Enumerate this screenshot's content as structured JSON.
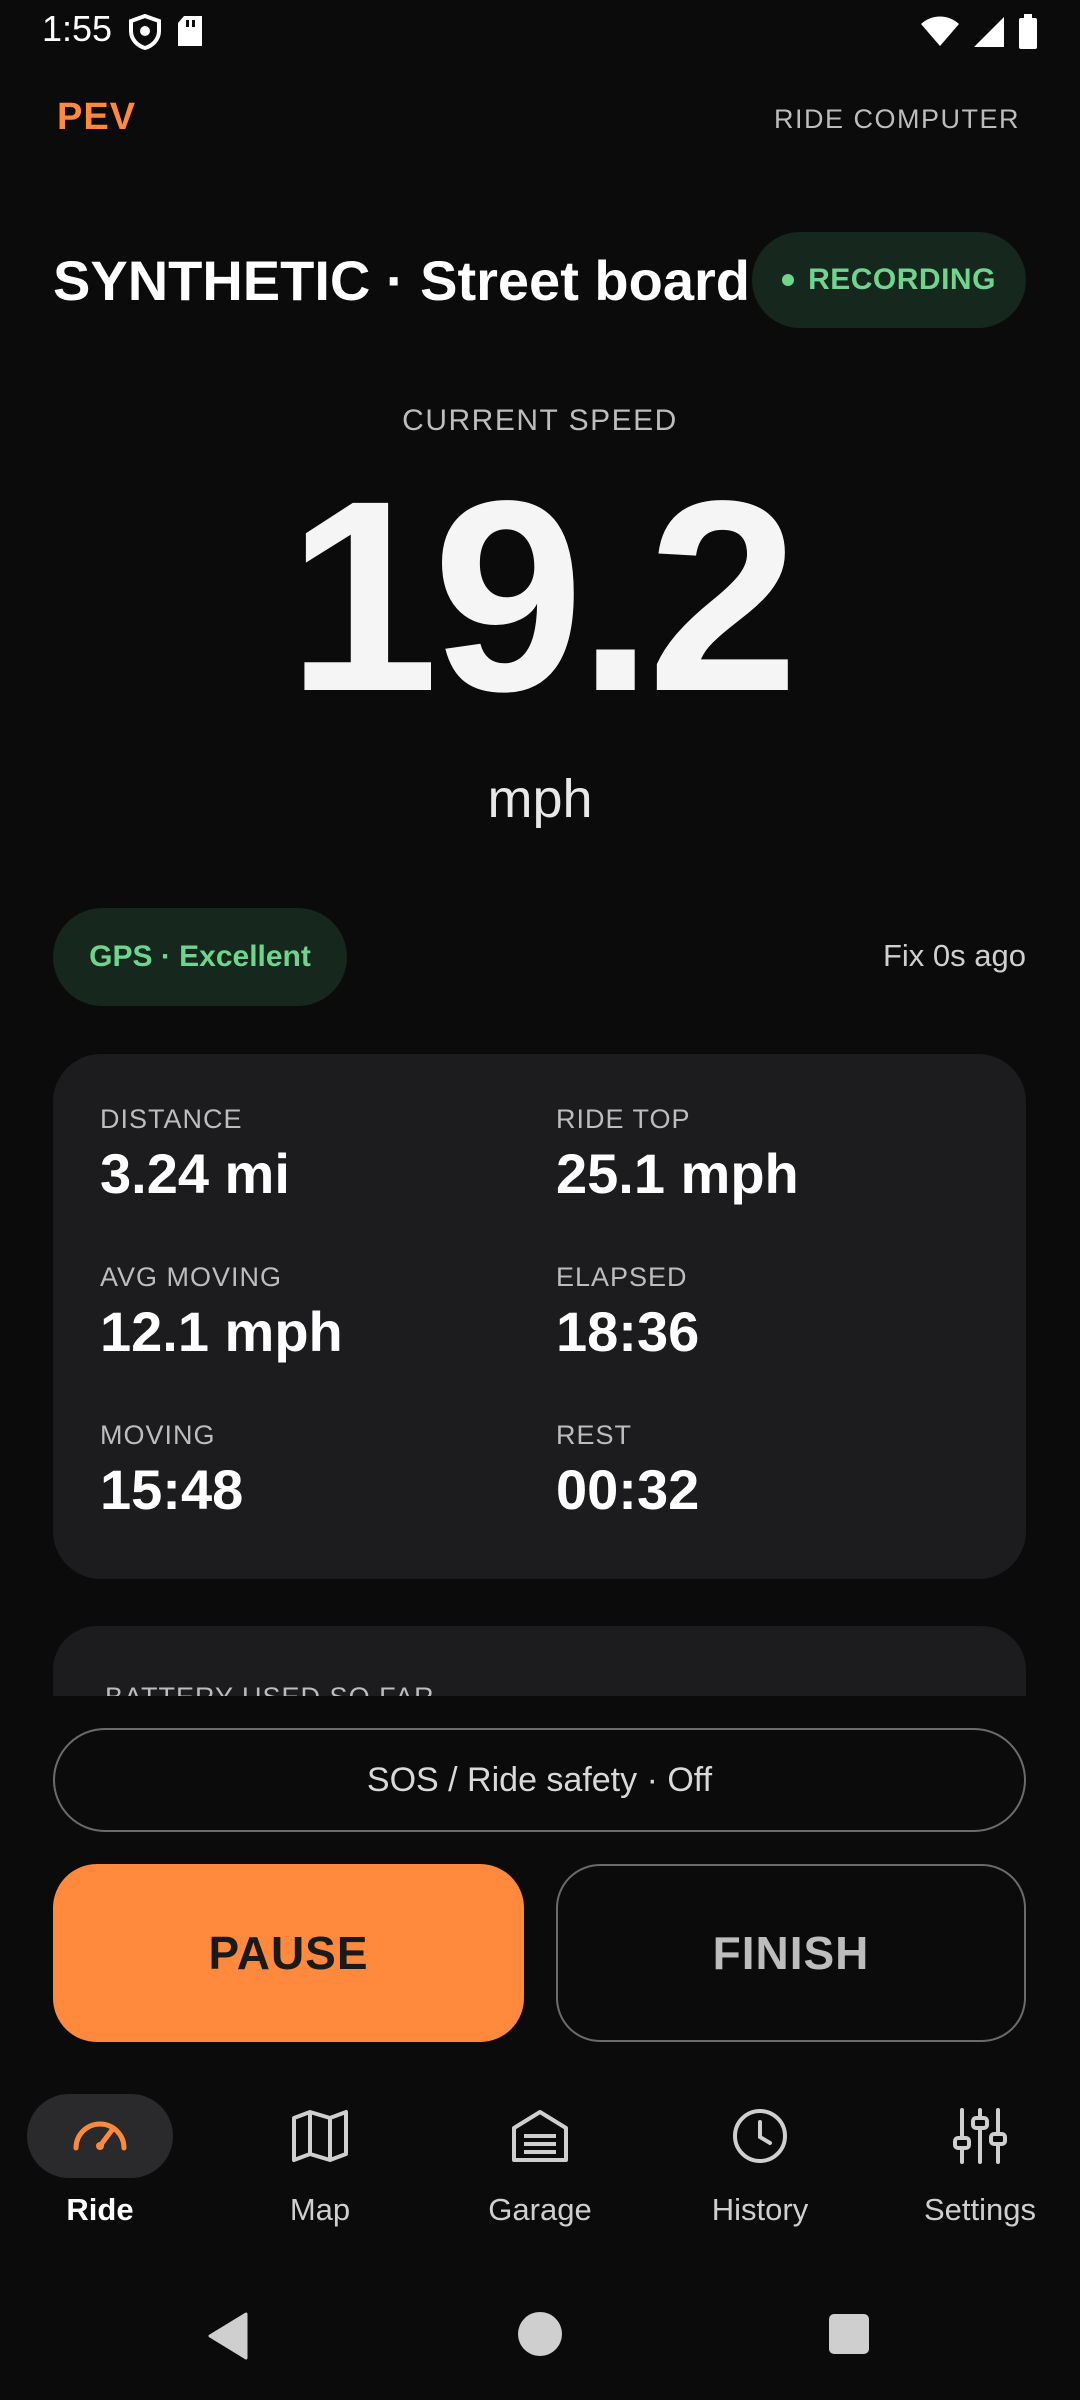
{
  "status_bar": {
    "time": "1:55",
    "left_icons": [
      "shield-icon",
      "sd-card-icon"
    ],
    "right_icons": [
      "wifi-icon",
      "cell-signal-icon",
      "battery-icon"
    ]
  },
  "app_bar": {
    "brand": "PEV",
    "subtitle": "RIDE COMPUTER"
  },
  "ride": {
    "title": "SYNTHETIC · Street board",
    "status": "RECORDING",
    "status_color": "#6fd58d"
  },
  "speed": {
    "label": "CURRENT SPEED",
    "value": "19.2",
    "unit": "mph"
  },
  "gps": {
    "status": "GPS · Excellent",
    "fix": "Fix 0s ago"
  },
  "stats": [
    {
      "label": "DISTANCE",
      "value": "3.24 mi"
    },
    {
      "label": "RIDE TOP",
      "value": "25.1 mph"
    },
    {
      "label": "AVG MOVING",
      "value": "12.1 mph"
    },
    {
      "label": "ELAPSED",
      "value": "18:36"
    },
    {
      "label": "MOVING",
      "value": "15:48"
    },
    {
      "label": "REST",
      "value": "00:32"
    }
  ],
  "battery": {
    "label": "BATTERY USED SO FAR"
  },
  "actions": {
    "sos": "SOS / Ride safety · Off",
    "pause": "PAUSE",
    "finish": "FINISH"
  },
  "nav": [
    {
      "label": "Ride",
      "icon": "speedometer-icon",
      "active": true
    },
    {
      "label": "Map",
      "icon": "map-icon",
      "active": false
    },
    {
      "label": "Garage",
      "icon": "garage-icon",
      "active": false
    },
    {
      "label": "History",
      "icon": "clock-icon",
      "active": false
    },
    {
      "label": "Settings",
      "icon": "sliders-icon",
      "active": false
    }
  ],
  "colors": {
    "accent": "#ff8a3d",
    "background": "#0b0b0c",
    "card": "#1c1c1e",
    "success": "#6fd58d"
  }
}
